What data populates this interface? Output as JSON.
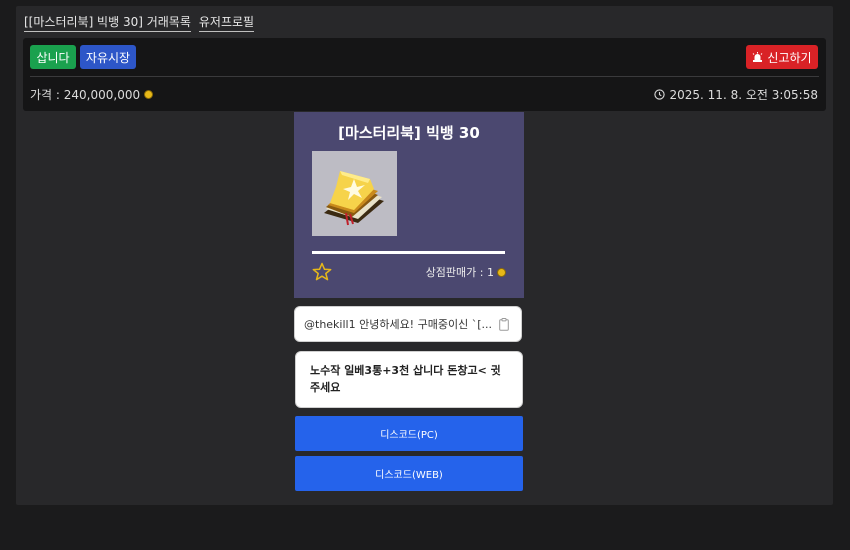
{
  "breadcrumbs": [
    "[[마스터리북] 빅뱅 30] 거래목록",
    "유저프로필"
  ],
  "toolbar": {
    "buy_label": "삽니다",
    "market_label": "자유시장",
    "report_label": "신고하기",
    "price_text": "가격 : 240,000,000",
    "timestamp": "2025. 11. 8. 오전 3:05:58"
  },
  "item": {
    "name": "[마스터리북] 빅뱅 30",
    "icon": "mastery-book-icon",
    "progress": 1.0,
    "shop_price_text": "상점판매가 : 1"
  },
  "chat": {
    "message1": "@thekill1 안녕하세요! 구매중이신 `[...",
    "message2": "노수작 일베3통+3천 삽니다 돈창고< 귓 주세요"
  },
  "actions": {
    "discord_pc": "디스코드(PC)",
    "discord_web": "디스코드(WEB)"
  },
  "colors": {
    "buy": "#1aa14e",
    "market": "#2d56c8",
    "report": "#d92226",
    "discord": "#2563eb",
    "card_bg": "#4b4870",
    "coin": "#e7b818"
  }
}
